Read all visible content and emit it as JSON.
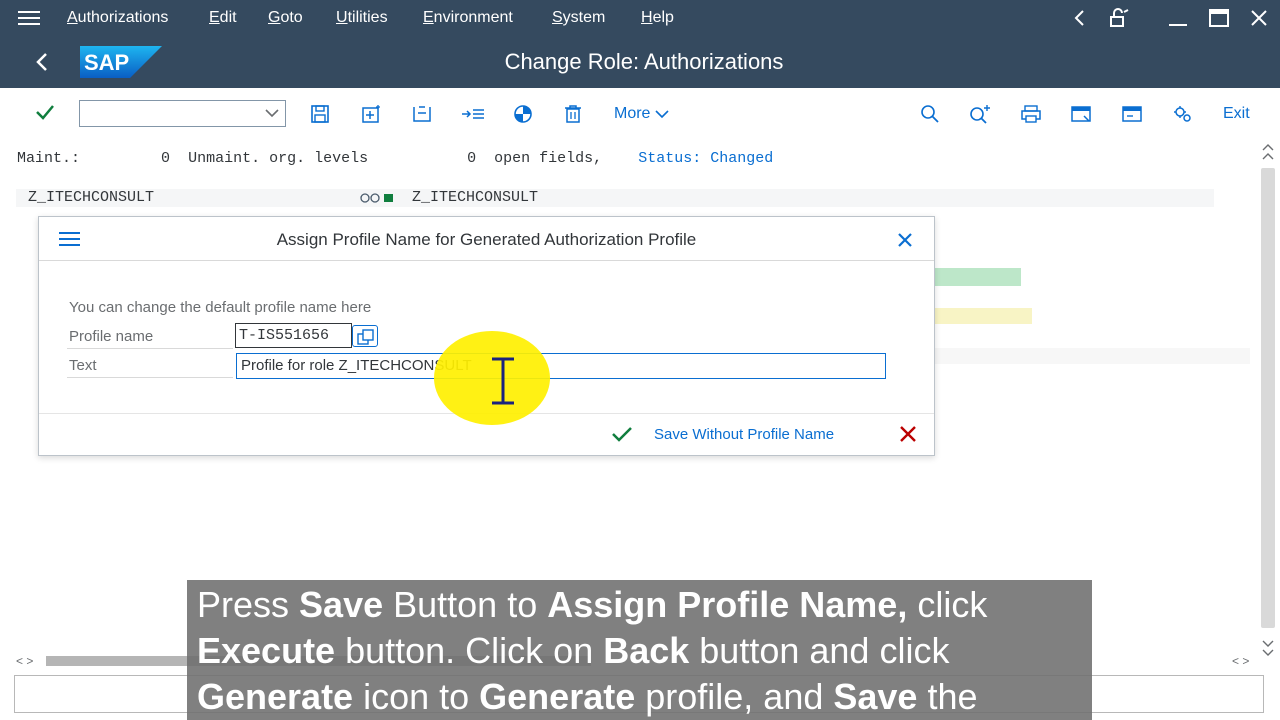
{
  "menubar": {
    "items": [
      "Authorizations",
      "Edit",
      "Goto",
      "Utilities",
      "Environment",
      "System",
      "Help"
    ]
  },
  "titlebar": {
    "logo_text": "SAP",
    "title": "Change Role: Authorizations"
  },
  "toolbar": {
    "command_field_value": "",
    "more_label": "More",
    "exit_label": "Exit"
  },
  "status": {
    "maint_label": "Maint.:",
    "maint_count": "0",
    "unmaint_label": "Unmaint. org. levels",
    "open_count": "0",
    "open_label": "open fields,",
    "status_text": "Status: Changed"
  },
  "role": {
    "name_left": "Z_ITECHCONSULT",
    "name_right": "Z_ITECHCONSULT"
  },
  "dialog": {
    "title": "Assign Profile Name for Generated Authorization Profile",
    "hint": "You can change the default profile name here",
    "profile_label": "Profile name",
    "profile_value": "T-IS551656",
    "text_label": "Text",
    "text_value": "Profile for role Z_ITECHCONSULT",
    "save_without_label": "Save Without Profile Name"
  },
  "caption": {
    "segments": [
      {
        "t": "Press ",
        "b": false
      },
      {
        "t": "Save",
        "b": true
      },
      {
        "t": " Button to ",
        "b": false
      },
      {
        "t": "Assign Profile Name,",
        "b": true
      },
      {
        "t": " click ",
        "b": false
      },
      {
        "t": "Execute",
        "b": true
      },
      {
        "t": " button. Click on ",
        "b": false
      },
      {
        "t": "Back",
        "b": true
      },
      {
        "t": " button and click ",
        "b": false
      },
      {
        "t": "Generate",
        "b": true
      },
      {
        "t": " icon to ",
        "b": false
      },
      {
        "t": "Generate",
        "b": true
      },
      {
        "t": " profile, and ",
        "b": false
      },
      {
        "t": "Save",
        "b": true
      },
      {
        "t": " the",
        "b": false
      }
    ]
  },
  "colors": {
    "shell": "#354a5f",
    "accent": "#0a6ed1",
    "ok_green": "#107e3e",
    "cancel_red": "#bb0000",
    "highlight": "#fff000"
  },
  "icons": [
    "menu-icon",
    "chevron-left-icon",
    "lock-icon",
    "minimize-icon",
    "maximize-icon",
    "close-icon",
    "checkmark-icon",
    "save-icon",
    "save-as-icon",
    "open-icon",
    "execute-icon",
    "pie-icon",
    "delete-icon",
    "chevron-down-icon",
    "search-icon",
    "search-next-icon",
    "print-icon",
    "window-icon",
    "window-new-icon",
    "settings-icon",
    "value-help-icon",
    "text-cursor-icon"
  ]
}
